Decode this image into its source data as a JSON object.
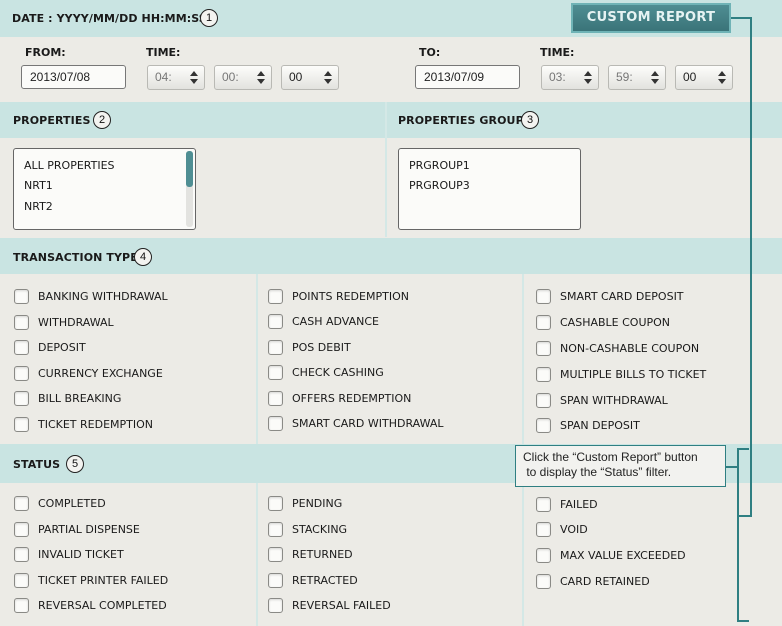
{
  "header": {
    "date_format_label": "DATE : YYYY/MM/DD HH:MM:SS",
    "step": "1",
    "custom_report_label": "CUSTOM REPORT"
  },
  "range": {
    "from_label": "FROM:",
    "from_date": "2013/07/08",
    "from_time_label": "TIME:",
    "from_hour": "04:",
    "from_minute": "00:",
    "from_second": "00",
    "to_label": "TO:",
    "to_date": "2013/07/09",
    "to_time_label": "TIME:",
    "to_hour": "03:",
    "to_minute": "59:",
    "to_second": "00"
  },
  "properties": {
    "title": "PROPERTIES",
    "step": "2",
    "items": [
      "ALL PROPERTIES",
      "NRT1",
      "NRT2"
    ]
  },
  "properties_group": {
    "title": "PROPERTIES GROUP",
    "step": "3",
    "items": [
      "PRGROUP1",
      "PRGROUP3"
    ]
  },
  "transaction_type": {
    "title": "TRANSACTION TYPE",
    "step": "4",
    "columns": [
      [
        "BANKING WITHDRAWAL",
        "WITHDRAWAL",
        "DEPOSIT",
        "CURRENCY EXCHANGE",
        "BILL BREAKING",
        "TICKET REDEMPTION"
      ],
      [
        "POINTS REDEMPTION",
        "CASH ADVANCE",
        "POS DEBIT",
        "CHECK CASHING",
        "OFFERS REDEMPTION",
        "SMART CARD WITHDRAWAL"
      ],
      [
        "SMART CARD DEPOSIT",
        "CASHABLE COUPON",
        "NON-CASHABLE COUPON",
        "MULTIPLE BILLS TO TICKET",
        "SPAN WITHDRAWAL",
        "SPAN DEPOSIT"
      ]
    ]
  },
  "status": {
    "title": "STATUS",
    "step": "5",
    "columns": [
      [
        "COMPLETED",
        "PARTIAL DISPENSE",
        "INVALID TICKET",
        "TICKET PRINTER FAILED",
        "REVERSAL COMPLETED"
      ],
      [
        "PENDING",
        "STACKING",
        "RETURNED",
        "RETRACTED",
        "REVERSAL FAILED"
      ],
      [
        "FAILED",
        "VOID",
        "MAX VALUE EXCEEDED",
        "CARD RETAINED"
      ]
    ]
  },
  "callout": {
    "line1": "Click the “Custom Report” button",
    "line2": " to display the “Status” filter."
  },
  "colors": {
    "band": "#c9e4e2",
    "button": "#3a7479",
    "callout_border": "#2f7f82",
    "scroll_thumb": "#4f8e93"
  }
}
